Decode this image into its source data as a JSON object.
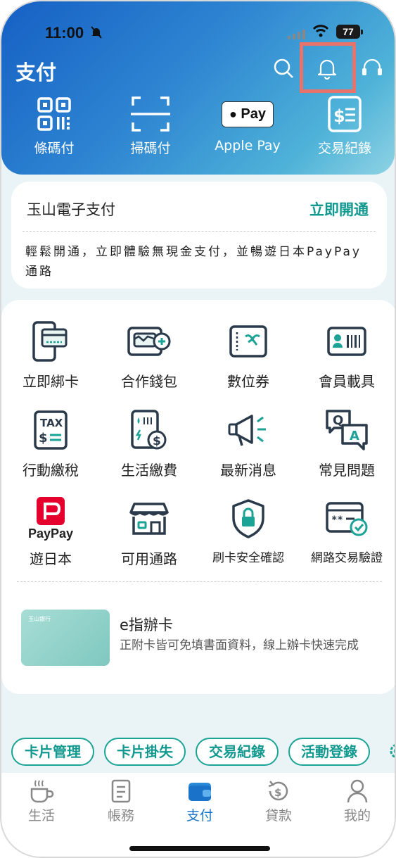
{
  "status": {
    "time": "11:00",
    "battery": "77"
  },
  "header": {
    "title": "支付"
  },
  "quick_actions": [
    {
      "label": "條碼付",
      "icon": "barcode-pay-icon"
    },
    {
      "label": "掃碼付",
      "icon": "scan-pay-icon"
    },
    {
      "label": "Apple Pay",
      "icon": "apple-pay-icon",
      "badge": "Pay"
    },
    {
      "label": "交易紀錄",
      "icon": "transaction-record-icon"
    }
  ],
  "epay_card": {
    "title": "玉山電子支付",
    "action": "立即開通",
    "description": "輕鬆開通，立即體驗無現金支付，並暢遊日本PayPay通路"
  },
  "services": [
    {
      "label": "立即綁卡",
      "icon": "bind-card-icon"
    },
    {
      "label": "合作錢包",
      "icon": "partner-wallet-icon"
    },
    {
      "label": "數位券",
      "icon": "digital-coupon-icon"
    },
    {
      "label": "會員載具",
      "icon": "member-carrier-icon"
    },
    {
      "label": "行動繳稅",
      "icon": "tax-payment-icon",
      "icon_text": "TAX"
    },
    {
      "label": "生活繳費",
      "icon": "bill-payment-icon"
    },
    {
      "label": "最新消息",
      "icon": "news-megaphone-icon"
    },
    {
      "label": "常見問題",
      "icon": "faq-icon",
      "icon_text_q": "Q",
      "icon_text_a": "A"
    },
    {
      "label": "遊日本",
      "icon": "paypay-icon",
      "brand": "PayPay"
    },
    {
      "label": "可用通路",
      "icon": "store-icon"
    },
    {
      "label": "刷卡安全確認",
      "icon": "security-lock-icon"
    },
    {
      "label": "網路交易驗證",
      "icon": "online-verify-icon"
    }
  ],
  "promo": {
    "title": "e指辦卡",
    "description": "正附卡皆可免填書面資料，線上辦卡快速完成",
    "card_bank": "玉山銀行"
  },
  "chips": [
    "卡片管理",
    "卡片掛失",
    "交易紀錄",
    "活動登錄"
  ],
  "tabs": [
    {
      "label": "生活",
      "icon": "coffee-icon"
    },
    {
      "label": "帳務",
      "icon": "bill-icon"
    },
    {
      "label": "支付",
      "icon": "wallet-icon",
      "active": true
    },
    {
      "label": "貸款",
      "icon": "loan-icon"
    },
    {
      "label": "我的",
      "icon": "person-icon"
    }
  ],
  "colors": {
    "accent": "#12998f",
    "tab_active": "#1a73c8",
    "icon_dark": "#2b3a4a",
    "highlight": "#e8736b"
  }
}
